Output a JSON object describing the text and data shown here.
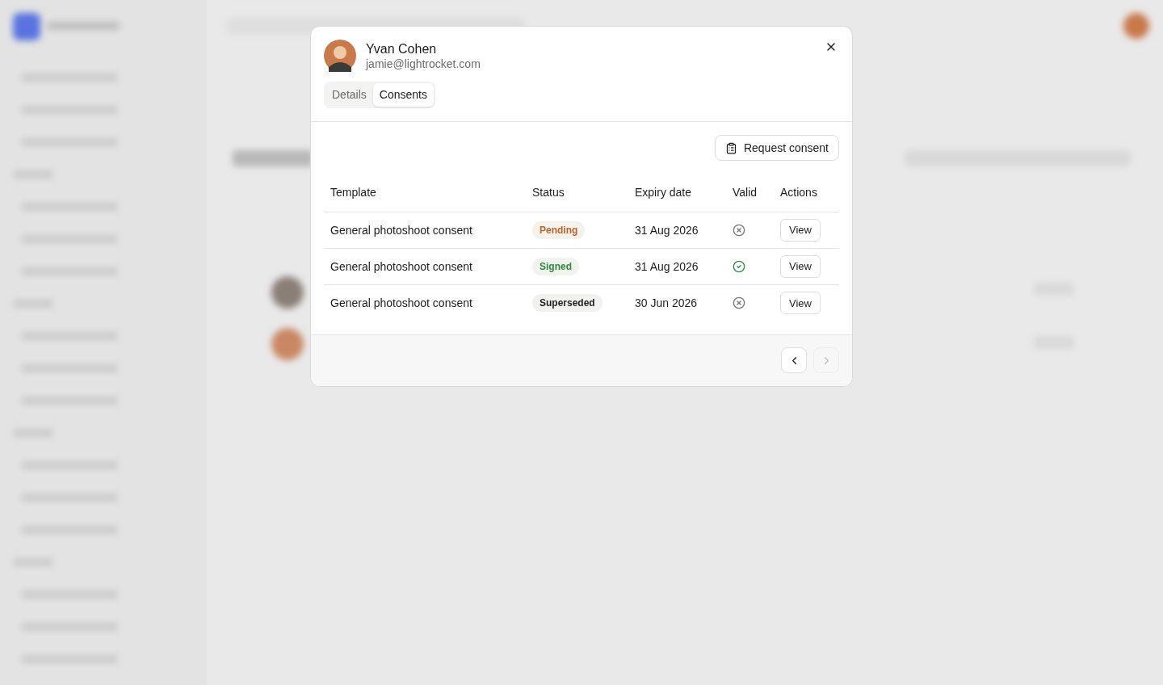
{
  "dialog": {
    "person": {
      "name": "Yvan Cohen",
      "email": "jamie@lightrocket.com"
    },
    "tabs": [
      {
        "label": "Details",
        "selected": false
      },
      {
        "label": "Consents",
        "selected": true
      }
    ],
    "request_button": "Request consent",
    "table": {
      "columns": [
        "Template",
        "Status",
        "Expiry date",
        "Valid",
        "Actions"
      ],
      "rows": [
        {
          "template": "General photoshoot consent",
          "status": {
            "label": "Pending",
            "kind": "pending"
          },
          "expiry": "31 Aug 2026",
          "valid": false,
          "action": "View"
        },
        {
          "template": "General photoshoot consent",
          "status": {
            "label": "Signed",
            "kind": "signed"
          },
          "expiry": "31 Aug 2026",
          "valid": true,
          "action": "View"
        },
        {
          "template": "General photoshoot consent",
          "status": {
            "label": "Superseded",
            "kind": "superseded"
          },
          "expiry": "30 Jun 2026",
          "valid": false,
          "action": "View"
        }
      ]
    },
    "pagination": {
      "previous_disabled": false,
      "next_disabled": true
    }
  }
}
